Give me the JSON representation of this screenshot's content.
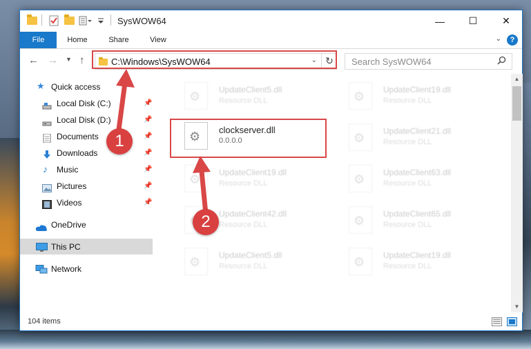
{
  "window": {
    "title": "SysWOW64",
    "controls": {
      "minimize": "—",
      "maximize": "☐",
      "close": "✕"
    }
  },
  "ribbon": {
    "tabs": [
      {
        "label": "File"
      },
      {
        "label": "Home"
      },
      {
        "label": "Share"
      },
      {
        "label": "View"
      }
    ],
    "help": "?"
  },
  "navigation": {
    "address_path": "C:\\Windows\\SysWOW64",
    "search_placeholder": "Search SysWOW64"
  },
  "sidebar": {
    "items": [
      {
        "label": "Quick access",
        "icon": "star-icon"
      },
      {
        "label": "Local Disk (C:)",
        "icon": "drive-icon",
        "pinned": true
      },
      {
        "label": "Local Disk (D:)",
        "icon": "drive-icon",
        "pinned": true
      },
      {
        "label": "Documents",
        "icon": "documents-icon",
        "pinned": true
      },
      {
        "label": "Downloads",
        "icon": "downloads-icon",
        "pinned": true
      },
      {
        "label": "Music",
        "icon": "music-icon",
        "pinned": true
      },
      {
        "label": "Pictures",
        "icon": "pictures-icon",
        "pinned": true
      },
      {
        "label": "Videos",
        "icon": "videos-icon",
        "pinned": true
      },
      {
        "label": "OneDrive",
        "icon": "cloud-icon"
      },
      {
        "label": "This PC",
        "icon": "computer-icon",
        "selected": true
      },
      {
        "label": "Network",
        "icon": "network-icon"
      }
    ]
  },
  "files": {
    "highlighted": {
      "name": "clockserver.dll",
      "version": "0.0.0.0"
    },
    "left_column": [
      {
        "name": "UpdateClient5.dll",
        "type": "Resource DLL"
      },
      {
        "name": "UpdateClient19.dll",
        "type": "Resource DLL"
      },
      {
        "name": "UpdateClient42.dll",
        "type": "Resource DLL"
      },
      {
        "name": "UpdateClient5.dll",
        "type": "Resource DLL"
      }
    ],
    "right_column": [
      {
        "name": "UpdateClient19.dll",
        "type": "Resource DLL"
      },
      {
        "name": "UpdateClient21.dll",
        "type": "Resource DLL"
      },
      {
        "name": "UpdateClient63.dll",
        "type": "Resource DLL"
      },
      {
        "name": "UpdateClient65.dll",
        "type": "Resource DLL"
      },
      {
        "name": "UpdateClient19.dll",
        "type": "Resource DLL"
      }
    ]
  },
  "status_bar": {
    "item_count": "104 items"
  },
  "annotations": {
    "step1": "1",
    "step2": "2",
    "color": "#d94747"
  }
}
